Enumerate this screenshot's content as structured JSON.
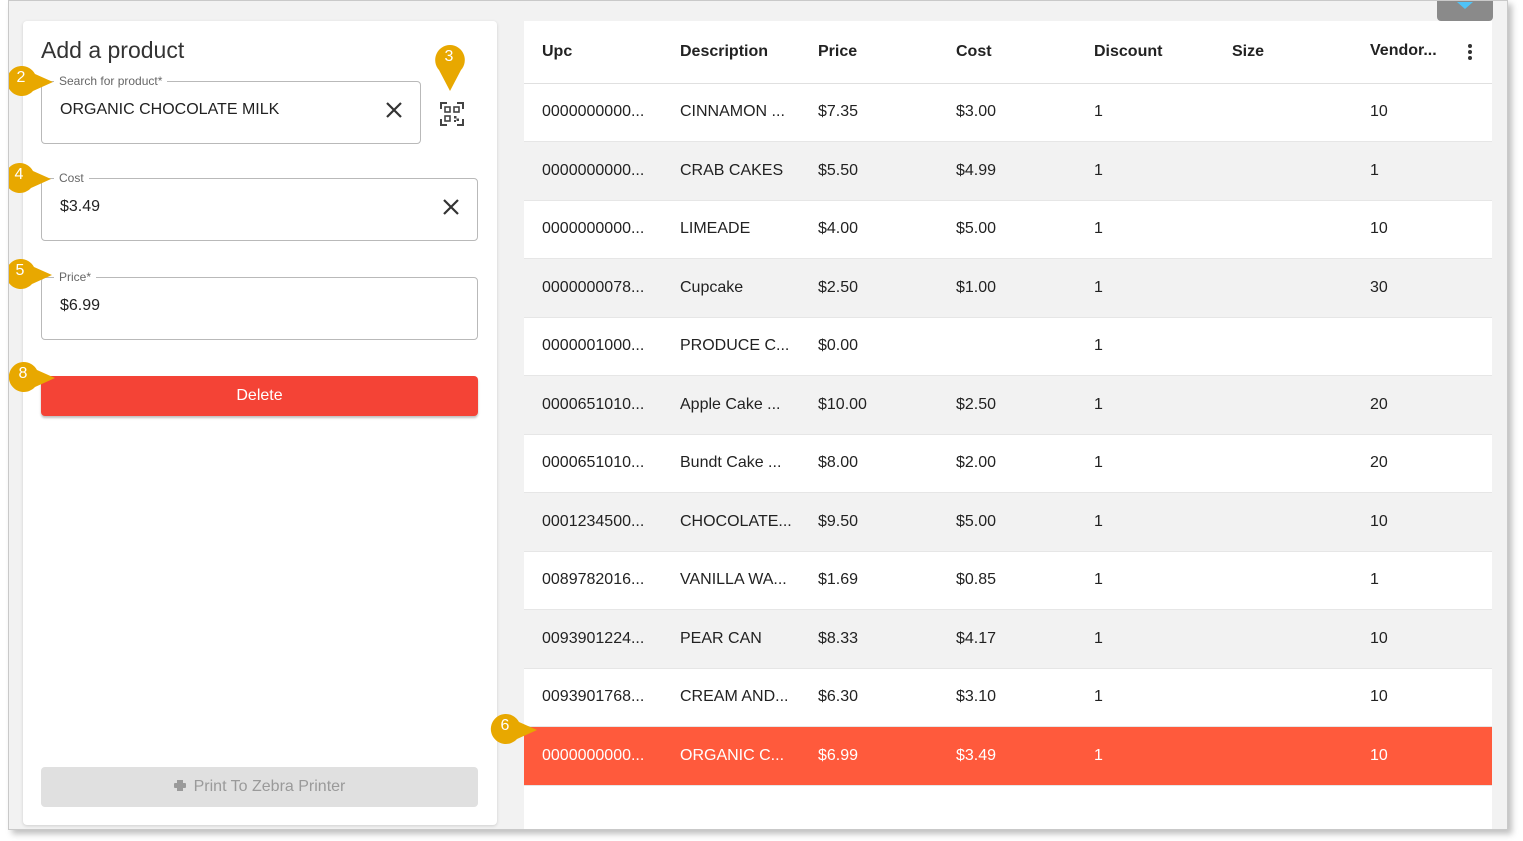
{
  "form": {
    "title": "Add a product",
    "search": {
      "label": "Search for product*",
      "value": "ORGANIC CHOCOLATE MILK"
    },
    "cost": {
      "label": "Cost",
      "value": "$3.49"
    },
    "price": {
      "label": "Price*",
      "value": "$6.99"
    },
    "delete_label": "Delete",
    "print_label": "Print To Zebra Printer"
  },
  "icons": {
    "scan": "qr-scan-icon",
    "clear": "close-icon",
    "print": "printer-icon",
    "menu": "more-vert-icon"
  },
  "colors": {
    "delete": "#f44336",
    "selected_row": "#ff5a3c",
    "callout": "#e8a800"
  },
  "callouts": [
    "2",
    "3",
    "4",
    "5",
    "8",
    "6"
  ],
  "table": {
    "headers": [
      "Upc",
      "Description",
      "Price",
      "Cost",
      "Discount",
      "Size",
      "Vendor..."
    ],
    "rows": [
      [
        "0000000000...",
        "CINNAMON ...",
        "$7.35",
        "$3.00",
        "1",
        "",
        "10"
      ],
      [
        "0000000000...",
        "CRAB CAKES",
        "$5.50",
        "$4.99",
        "1",
        "",
        "1"
      ],
      [
        "0000000000...",
        "LIMEADE",
        "$4.00",
        "$5.00",
        "1",
        "",
        "10"
      ],
      [
        "0000000078...",
        "Cupcake",
        "$2.50",
        "$1.00",
        "1",
        "",
        "30"
      ],
      [
        "0000001000...",
        "PRODUCE C...",
        "$0.00",
        "",
        "1",
        "",
        ""
      ],
      [
        "0000651010...",
        "Apple Cake ...",
        "$10.00",
        "$2.50",
        "1",
        "",
        "20"
      ],
      [
        "0000651010...",
        "Bundt Cake ...",
        "$8.00",
        "$2.00",
        "1",
        "",
        "20"
      ],
      [
        "0001234500...",
        "CHOCOLATE...",
        "$9.50",
        "$5.00",
        "1",
        "",
        "10"
      ],
      [
        "0089782016...",
        "VANILLA WA...",
        "$1.69",
        "$0.85",
        "1",
        "",
        "1"
      ],
      [
        "0093901224...",
        "PEAR CAN",
        "$8.33",
        "$4.17",
        "1",
        "",
        "10"
      ],
      [
        "0093901768...",
        "CREAM AND...",
        "$6.30",
        "$3.10",
        "1",
        "",
        "10"
      ],
      [
        "0000000000...",
        "ORGANIC C...",
        "$6.99",
        "$3.49",
        "1",
        "",
        "10"
      ]
    ],
    "selected_index": 11
  }
}
